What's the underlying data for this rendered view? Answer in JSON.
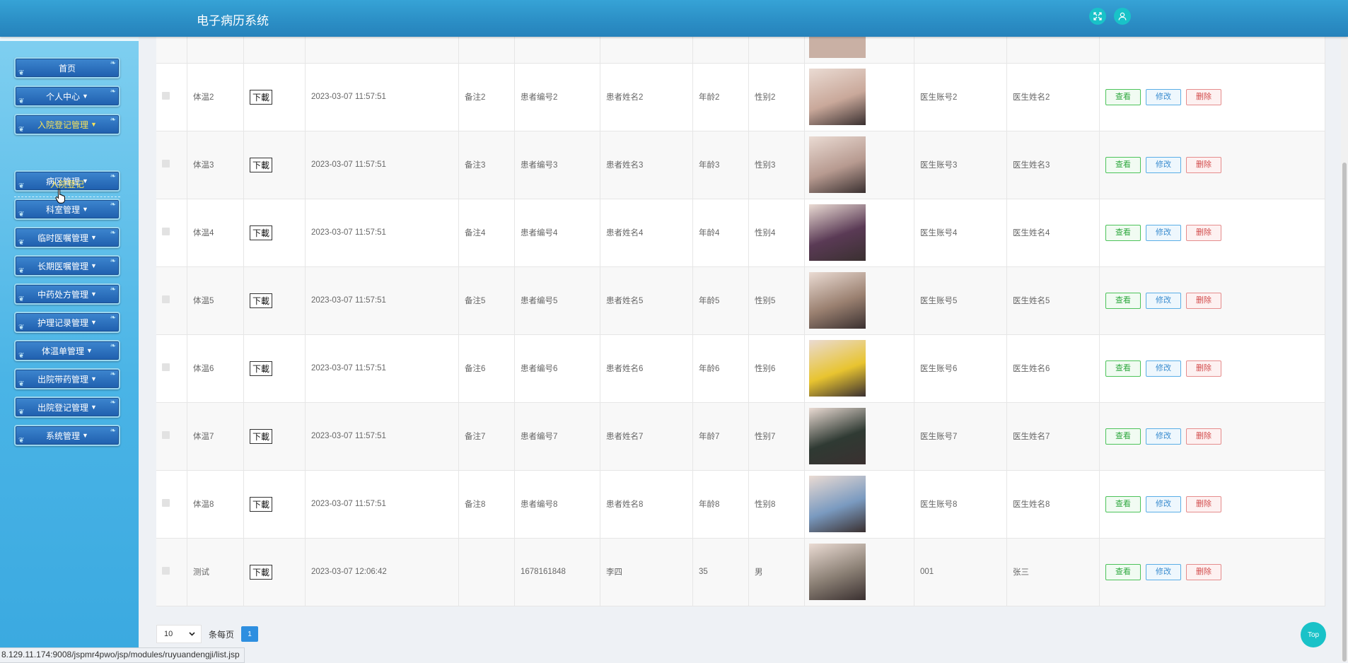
{
  "header": {
    "title": "电子病历系统",
    "fullscreen_icon": "expand-icon",
    "user_icon": "user-icon"
  },
  "sidebar": {
    "items": [
      {
        "label": "首页",
        "dropdown": false
      },
      {
        "label": "个人中心",
        "dropdown": true
      },
      {
        "label": "入院登记管理",
        "dropdown": true,
        "active": true
      },
      {
        "label": "病区管理",
        "dropdown": true
      },
      {
        "label": "科室管理",
        "dropdown": true
      },
      {
        "label": "临时医嘱管理",
        "dropdown": true
      },
      {
        "label": "长期医嘱管理",
        "dropdown": true
      },
      {
        "label": "中药处方管理",
        "dropdown": true
      },
      {
        "label": "护理记录管理",
        "dropdown": true
      },
      {
        "label": "体温单管理",
        "dropdown": true
      },
      {
        "label": "出院带药管理",
        "dropdown": true
      },
      {
        "label": "出院登记管理",
        "dropdown": true
      },
      {
        "label": "系统管理",
        "dropdown": true
      }
    ],
    "submenu_label": "入院登记"
  },
  "table": {
    "download_label": "下載",
    "actions": {
      "view": "查看",
      "edit": "修改",
      "delete": "删除"
    },
    "rows": [
      {
        "temp": "体温2",
        "time": "2023-03-07 11:57:51",
        "note": "备注2",
        "patient_no": "患者编号2",
        "patient_name": "患者姓名2",
        "age": "年龄2",
        "sex": "性别2",
        "doctor_acct": "医生账号2",
        "doctor_name": "医生姓名2",
        "photo_color": "#c9a89a"
      },
      {
        "temp": "体温3",
        "time": "2023-03-07 11:57:51",
        "note": "备注3",
        "patient_no": "患者编号3",
        "patient_name": "患者姓名3",
        "age": "年龄3",
        "sex": "性别3",
        "doctor_acct": "医生账号3",
        "doctor_name": "医生姓名3",
        "photo_color": "#b79a90"
      },
      {
        "temp": "体温4",
        "time": "2023-03-07 11:57:51",
        "note": "备注4",
        "patient_no": "患者编号4",
        "patient_name": "患者姓名4",
        "age": "年龄4",
        "sex": "性别4",
        "doctor_acct": "医生账号4",
        "doctor_name": "医生姓名4",
        "photo_color": "#5a3a55"
      },
      {
        "temp": "体温5",
        "time": "2023-03-07 11:57:51",
        "note": "备注5",
        "patient_no": "患者编号5",
        "patient_name": "患者姓名5",
        "age": "年龄5",
        "sex": "性别5",
        "doctor_acct": "医生账号5",
        "doctor_name": "医生姓名5",
        "photo_color": "#9a8070"
      },
      {
        "temp": "体温6",
        "time": "2023-03-07 11:57:51",
        "note": "备注6",
        "patient_no": "患者编号6",
        "patient_name": "患者姓名6",
        "age": "年龄6",
        "sex": "性别6",
        "doctor_acct": "医生账号6",
        "doctor_name": "医生姓名6",
        "photo_color": "#e8c430"
      },
      {
        "temp": "体温7",
        "time": "2023-03-07 11:57:51",
        "note": "备注7",
        "patient_no": "患者编号7",
        "patient_name": "患者姓名7",
        "age": "年龄7",
        "sex": "性别7",
        "doctor_acct": "医生账号7",
        "doctor_name": "医生姓名7",
        "photo_color": "#2f3a33"
      },
      {
        "temp": "体温8",
        "time": "2023-03-07 11:57:51",
        "note": "备注8",
        "patient_no": "患者编号8",
        "patient_name": "患者姓名8",
        "age": "年龄8",
        "sex": "性别8",
        "doctor_acct": "医生账号8",
        "doctor_name": "医生姓名8",
        "photo_color": "#7a9ac0"
      },
      {
        "temp": "测试",
        "time": "2023-03-07 12:06:42",
        "note": "",
        "patient_no": "1678161848",
        "patient_name": "李四",
        "age": "35",
        "sex": "男",
        "doctor_acct": "001",
        "doctor_name": "张三",
        "photo_color": "#8a7f74"
      }
    ]
  },
  "pager": {
    "page_size": "10",
    "per_page_label": "条每页",
    "current_page": "1"
  },
  "totop_label": "Top",
  "status_url": "8.129.11.174:9008/jspmr4pwo/jsp/modules/ruyuandengji/list.jsp"
}
